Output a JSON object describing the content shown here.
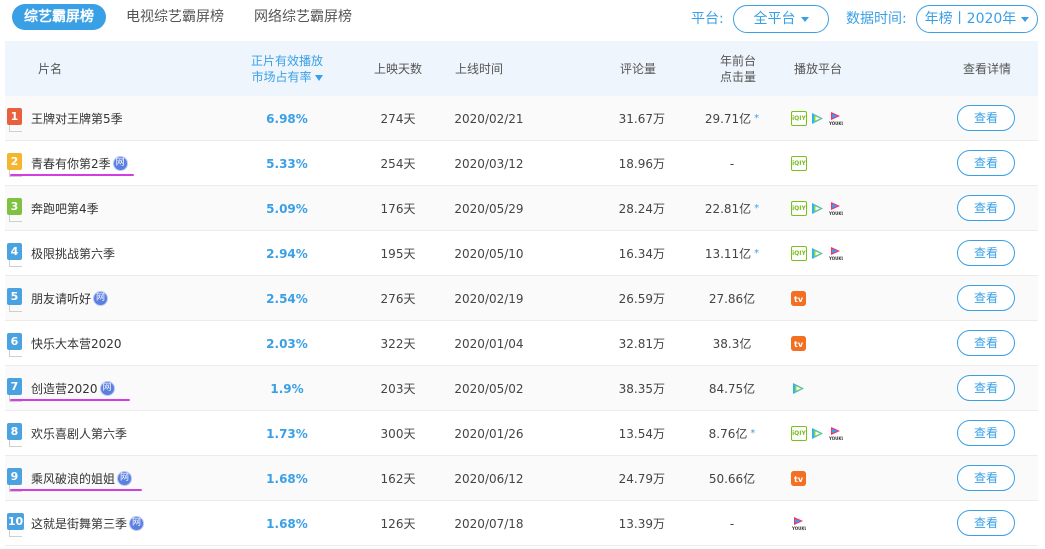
{
  "tabs": [
    {
      "label": "综艺霸屏榜",
      "active": true
    },
    {
      "label": "电视综艺霸屏榜",
      "active": false
    },
    {
      "label": "网络综艺霸屏榜",
      "active": false
    }
  ],
  "filters": {
    "platform_label": "平台:",
    "platform_value": "全平台",
    "time_label": "数据时间:",
    "time_value": "年榜丨2020年"
  },
  "columns": {
    "name": "片名",
    "share_line1": "正片有效播放",
    "share_line2": "市场占有率",
    "days": "上映天数",
    "date": "上线时间",
    "comments": "评论量",
    "clicks_line1": "年前台",
    "clicks_line2": "点击量",
    "platforms": "播放平台",
    "details": "查看详情"
  },
  "badge_text": "网",
  "view_label": "查看",
  "colors": {
    "accent": "#3aa0e6",
    "rank1": "#e8603c",
    "rank2": "#f5b52e",
    "rank3": "#7fc242",
    "rank_other": "#4aa3e0",
    "highlight_underline": "#d33ee0"
  },
  "rows": [
    {
      "rank": "1",
      "name": "王牌对王牌第5季",
      "net": false,
      "share": "6.98%",
      "days": "274天",
      "date": "2020/02/21",
      "comments": "31.67万",
      "clicks": "29.71亿",
      "clicks_star": true,
      "platforms": [
        "iqiyi",
        "tencent",
        "youku"
      ],
      "underlined": false
    },
    {
      "rank": "2",
      "name": "青春有你第2季",
      "net": true,
      "share": "5.33%",
      "days": "254天",
      "date": "2020/03/12",
      "comments": "18.96万",
      "clicks": "-",
      "clicks_star": false,
      "platforms": [
        "iqiyi"
      ],
      "underlined": true
    },
    {
      "rank": "3",
      "name": "奔跑吧第4季",
      "net": false,
      "share": "5.09%",
      "days": "176天",
      "date": "2020/05/29",
      "comments": "28.24万",
      "clicks": "22.81亿",
      "clicks_star": true,
      "platforms": [
        "iqiyi",
        "tencent",
        "youku"
      ],
      "underlined": false
    },
    {
      "rank": "4",
      "name": "极限挑战第六季",
      "net": false,
      "share": "2.94%",
      "days": "195天",
      "date": "2020/05/10",
      "comments": "16.34万",
      "clicks": "13.11亿",
      "clicks_star": true,
      "platforms": [
        "iqiyi",
        "tencent",
        "youku"
      ],
      "underlined": false
    },
    {
      "rank": "5",
      "name": "朋友请听好",
      "net": true,
      "share": "2.54%",
      "days": "276天",
      "date": "2020/02/19",
      "comments": "26.59万",
      "clicks": "27.86亿",
      "clicks_star": false,
      "platforms": [
        "mango"
      ],
      "underlined": false
    },
    {
      "rank": "6",
      "name": "快乐大本营2020",
      "net": false,
      "share": "2.03%",
      "days": "322天",
      "date": "2020/01/04",
      "comments": "32.81万",
      "clicks": "38.3亿",
      "clicks_star": false,
      "platforms": [
        "mango"
      ],
      "underlined": false
    },
    {
      "rank": "7",
      "name": "创造营2020",
      "net": true,
      "share": "1.9%",
      "days": "203天",
      "date": "2020/05/02",
      "comments": "38.35万",
      "clicks": "84.75亿",
      "clicks_star": false,
      "platforms": [
        "tencent"
      ],
      "underlined": true
    },
    {
      "rank": "8",
      "name": "欢乐喜剧人第六季",
      "net": false,
      "share": "1.73%",
      "days": "300天",
      "date": "2020/01/26",
      "comments": "13.54万",
      "clicks": "8.76亿",
      "clicks_star": true,
      "platforms": [
        "iqiyi",
        "tencent",
        "youku"
      ],
      "underlined": false
    },
    {
      "rank": "9",
      "name": "乘风破浪的姐姐",
      "net": true,
      "share": "1.68%",
      "days": "162天",
      "date": "2020/06/12",
      "comments": "24.79万",
      "clicks": "50.66亿",
      "clicks_star": false,
      "platforms": [
        "mango"
      ],
      "underlined": true
    },
    {
      "rank": "10",
      "name": "这就是街舞第三季",
      "net": true,
      "share": "1.68%",
      "days": "126天",
      "date": "2020/07/18",
      "comments": "13.39万",
      "clicks": "-",
      "clicks_star": false,
      "platforms": [
        "youku"
      ],
      "underlined": false
    }
  ]
}
